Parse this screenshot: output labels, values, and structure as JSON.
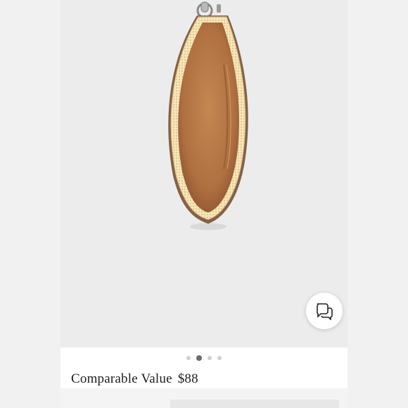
{
  "listing": {
    "image_alt": "Brown zip pouch shown open with tan lining",
    "carousel": {
      "total": 4,
      "active_index": 1
    },
    "price_label": "Comparable Value",
    "price_value": "$88"
  },
  "icons": {
    "chat": "chat-bubbles-icon"
  },
  "colors": {
    "lining": "#b87a45",
    "zipper": "#f3e2b0",
    "page_bg": "#f1f1f1",
    "panel_bg": "#ffffff"
  }
}
